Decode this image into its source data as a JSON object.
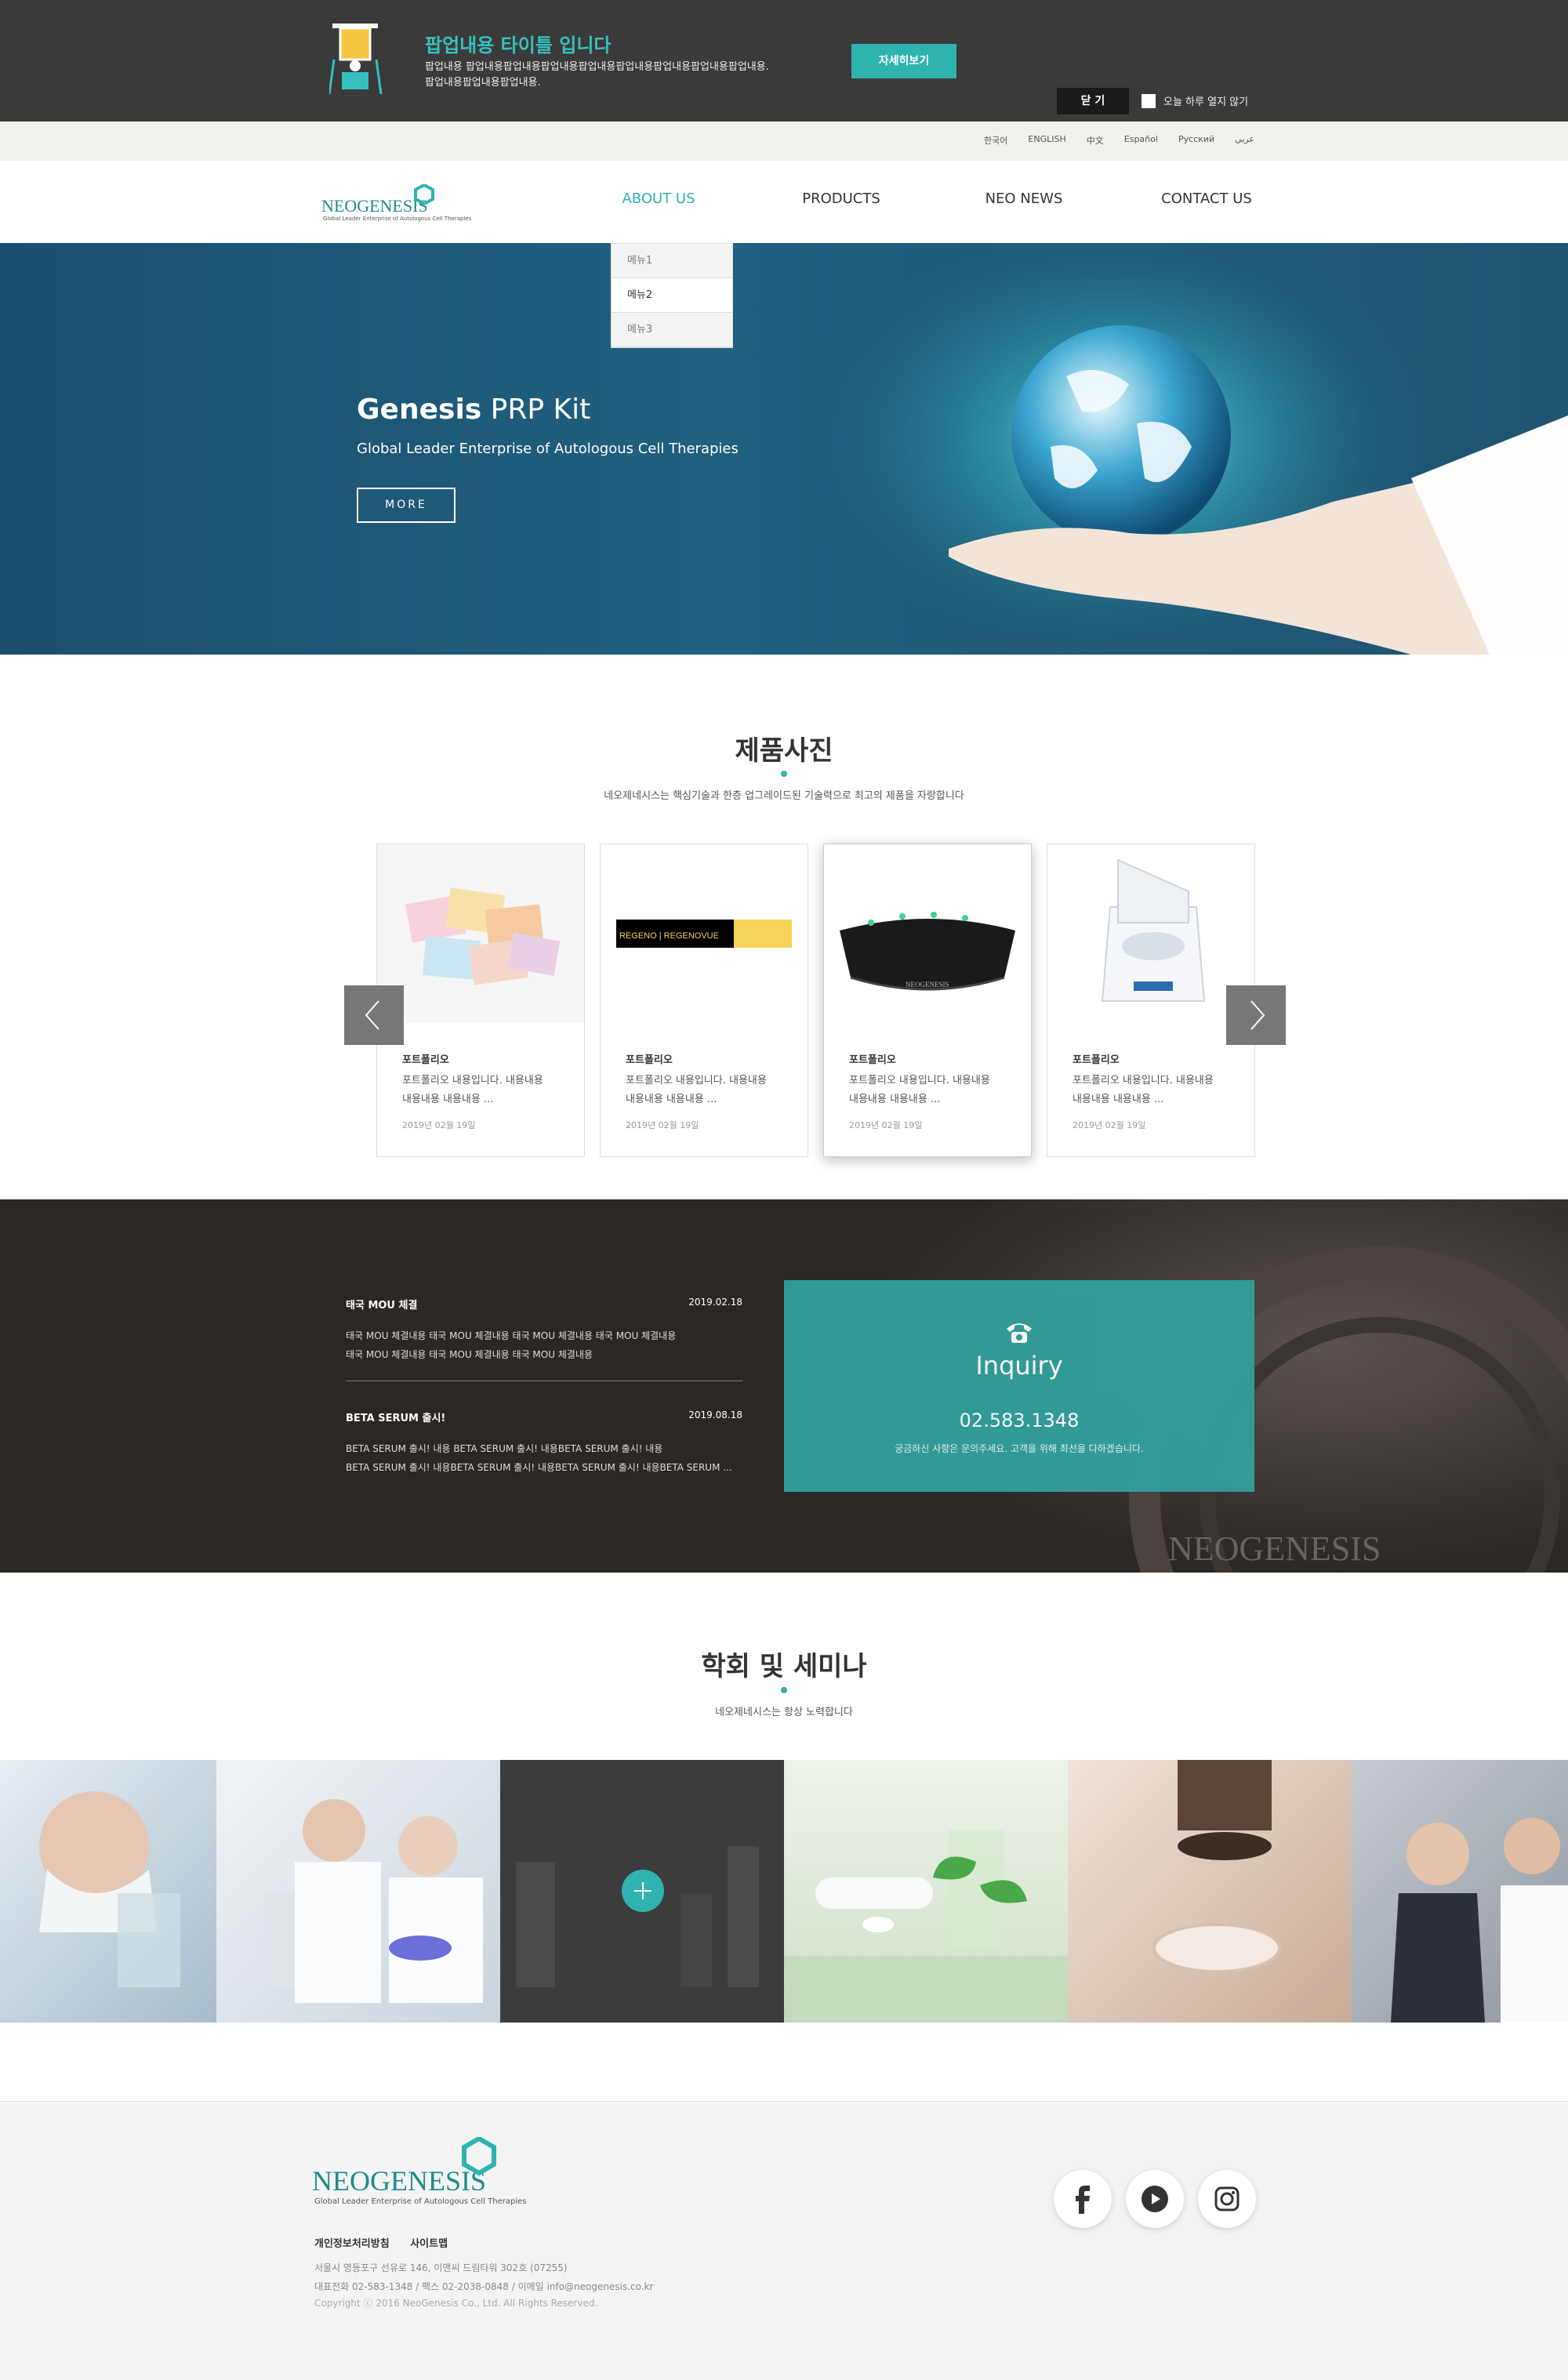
{
  "popup": {
    "title": "팝업내용 타이틀 입니다",
    "desc_line1": "팝업내용 팝업내용팝업내용팝업내용팝업내용팝업내용팝업내용팝업내용팝업내용.",
    "desc_line2": "팝업내용팝업내용팝업내용.",
    "detail_button": "자세히보기",
    "close_button": "닫 기",
    "dont_show_today": "오늘 하루 열지 않기"
  },
  "languages": [
    "한국어",
    "ENGLISH",
    "中文",
    "Español",
    "Русский",
    "عربي"
  ],
  "logo": {
    "name": "NEOGENESIS",
    "tagline": "Global Leader Enterprise of Autologous Cell Therapies"
  },
  "nav": {
    "items": [
      "ABOUT US",
      "PRODUCTS",
      "NEO NEWS",
      "CONTACT US"
    ],
    "active_color": "#2fb3b0",
    "dropdown": [
      "메뉴1",
      "메뉴2",
      "메뉴3"
    ]
  },
  "hero": {
    "title_bold": "Genesis",
    "title_rest": " PRP Kit",
    "subtitle": "Global Leader Enterprise of Autologous Cell Therapies",
    "more_button": "MORE"
  },
  "products": {
    "title": "제품사진",
    "subtitle": "네오제네시스는 핵심기술과 한층 업그레이드된 기술력으로 최고의 제품을 자랑합니다",
    "cards": [
      {
        "title": "포트폴리오",
        "desc1": "포트폴리오 내용입니다. 내용내용",
        "desc2": "내용내용 내용내용 ...",
        "date": "2019년 02월 19일"
      },
      {
        "title": "포트폴리오",
        "desc1": "포트폴리오 내용입니다. 내용내용",
        "desc2": "내용내용 내용내용 ...",
        "date": "2019년 02월 19일"
      },
      {
        "title": "포트폴리오",
        "desc1": "포트폴리오 내용입니다. 내용내용",
        "desc2": "내용내용 내용내용 ...",
        "date": "2019년 02월 19일"
      },
      {
        "title": "포트폴리오",
        "desc1": "포트폴리오 내용입니다. 내용내용",
        "desc2": "내용내용 내용내용 ...",
        "date": "2019년 02월 19일"
      }
    ],
    "card2_label": "REGENO | REGENOVUE",
    "card3_label": "NEOGENESIS"
  },
  "news": {
    "items": [
      {
        "title": "태국 MOU 체결",
        "date": "2019.02.18",
        "line1": "태국 MOU 체결내용 태국 MOU 체결내용 태국 MOU 체결내용 태국 MOU 체결내용",
        "line2": "태국 MOU 체결내용 태국 MOU 체결내용 태국 MOU 체결내용"
      },
      {
        "title": "BETA SERUM 출시!",
        "date": "2019.08.18",
        "line1": "BETA SERUM 출시! 내용   BETA SERUM 출시! 내용BETA SERUM 출시! 내용",
        "line2": "BETA SERUM 출시! 내용BETA SERUM 출시! 내용BETA SERUM 출시! 내용BETA SERUM ..."
      }
    ],
    "inquiry": {
      "title": "Inquiry",
      "phone": "02.583.1348",
      "desc": "궁금하신 사항은 문의주세요. 고객을 위해 최선을 다하겠습니다."
    },
    "watermark": "NEOGENESIS"
  },
  "seminar": {
    "title": "학회 및 세미나",
    "subtitle": "네오제네시스는 항상 노력합니다"
  },
  "footer": {
    "logo": "NEOGENESIS",
    "tagline": "Global Leader Enterprise of Autologous Cell Therapies",
    "link_privacy": "개인정보처리방침",
    "link_sitemap": "사이트맵",
    "address": "서울시 영등포구 선유로 146, 이앤씨 드림타워 302호 (07255)",
    "contact": "대표전화 02-583-1348  /  팩스 02-2038-0848  /  이메일 info@neogenesis.co.kr",
    "copyright": "Copyright ⓒ 2016 NeoGenesis Co., Ltd. All Rights Reserved."
  },
  "colors": {
    "accent": "#2fb3b0",
    "dark": "#3a3a3a",
    "hero": "#1e5470"
  }
}
